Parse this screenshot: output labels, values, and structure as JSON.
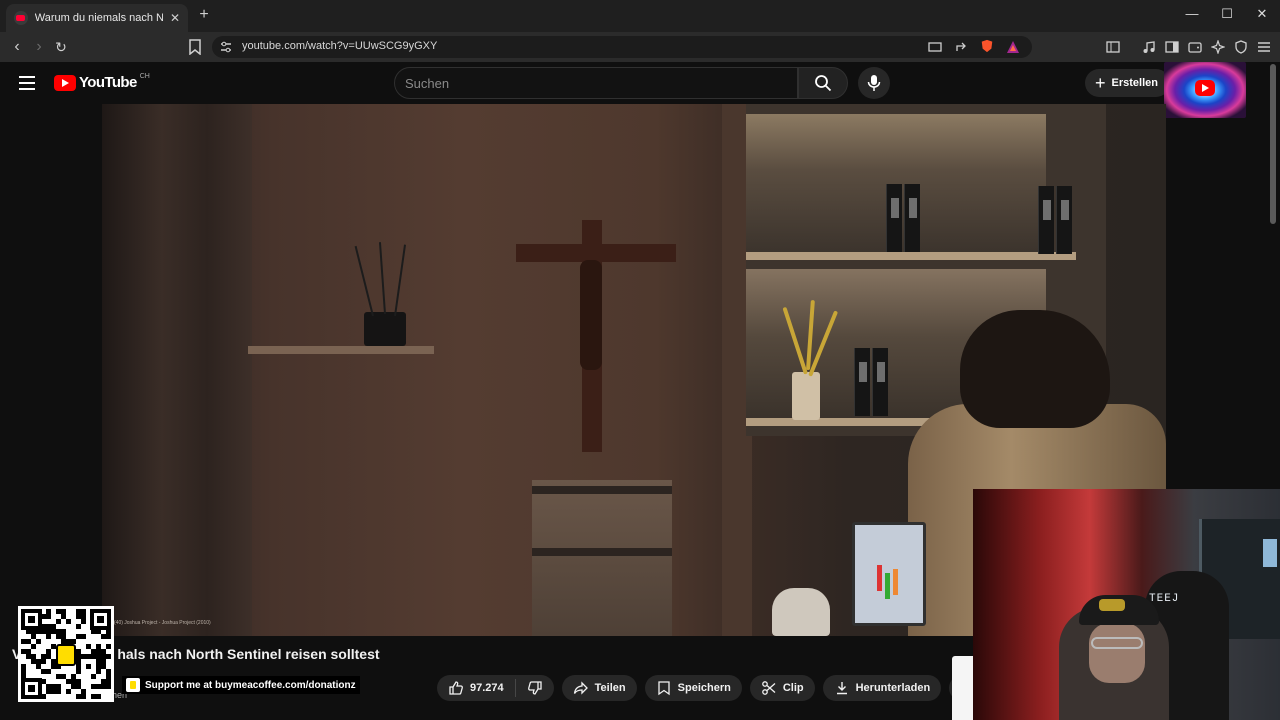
{
  "browser": {
    "tab_title": "Warum du niemals nach North S",
    "tab_close": "✕",
    "new_tab": "+",
    "url": "youtube.com/watch?v=UUwSCG9yGXY",
    "window_minimize": "—",
    "window_maximize": "☐",
    "window_close": "✕"
  },
  "youtube": {
    "logo_word": "YouTube",
    "country_code": "CH",
    "search_placeholder": "Suchen",
    "create_label": "Erstellen",
    "video_title_visible": "hals nach North Sentinel reisen solltest",
    "video_title_first_char": "V",
    "video_caption": "(40) Joshua Project - Joshua Project (2010)",
    "channel_sub_fragment": "hen",
    "actions": {
      "like_count": "97.274",
      "share": "Teilen",
      "save": "Speichern",
      "clip": "Clip",
      "download": "Herunterladen",
      "more": "•••"
    }
  },
  "overlays": {
    "donate_text": "Support me at buymeacoffee.com/donationz",
    "webcam_neon": "TEEJ"
  },
  "colors": {
    "background": "#0f0f0f",
    "youtube_red": "#ff0000",
    "chip": "#272727",
    "bmc_yellow": "#ffdd00"
  }
}
